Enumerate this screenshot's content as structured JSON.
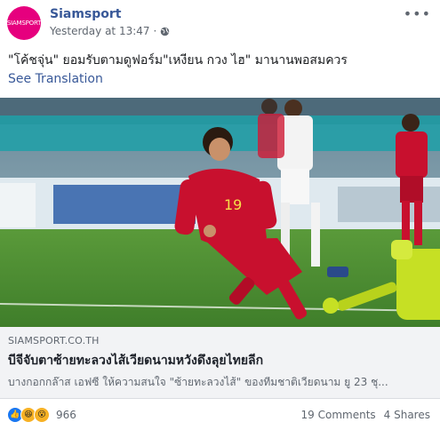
{
  "post": {
    "page_name": "Siamsport",
    "avatar_text": "SIAMSPORT",
    "timestamp": "Yesterday at 13:47",
    "audience_icon": "globe-icon",
    "more_icon": "more-options-icon",
    "text": "\"โค้ชจุ่น\" ยอมรับตามดูฟอร์ม\"เหงียน กวง ไฮ\" มานานพอสมควร",
    "see_translation": "See Translation"
  },
  "photo": {
    "jersey_number": "19"
  },
  "link_preview": {
    "domain": "SIAMSPORT.CO.TH",
    "title": "บีจีจับตาซ้ายทะลวงไส้เวียดนามหวังดึงลุยไทยลีก",
    "description": "บางกอกกล๊าส เอฟซี ให้ความสนใจ \"ซ้ายทะลวงไส้\" ของทีมชาติเวียดนาม ยู 23 ชุ..."
  },
  "footer": {
    "reaction_icons": [
      "like-icon",
      "haha-icon",
      "wow-icon"
    ],
    "reaction_count": "966",
    "comments": "19 Comments",
    "shares": "4 Shares"
  },
  "colors": {
    "brand_pink": "#e6007e",
    "link_blue": "#385898",
    "jersey_red": "#c8102e"
  }
}
